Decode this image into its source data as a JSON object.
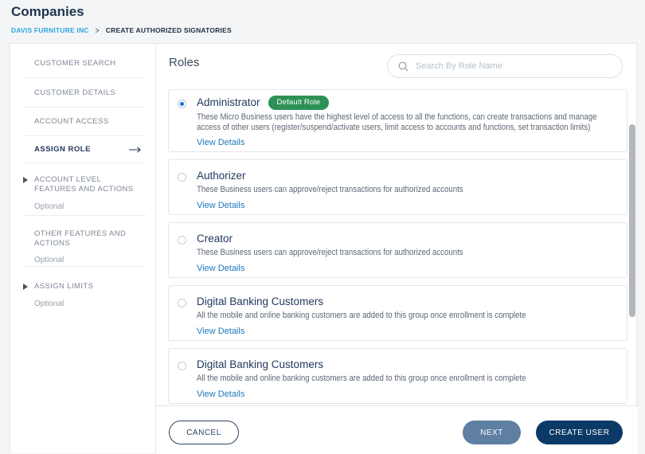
{
  "header": {
    "title": "Companies",
    "breadcrumb": {
      "parent": "DAVIS FURNITURE INC",
      "separator": ">",
      "current": "CREATE AUTHORIZED SIGNATORIES"
    }
  },
  "sidebar": {
    "items": [
      {
        "label": "CUSTOMER SEARCH"
      },
      {
        "label": "CUSTOMER DETAILS"
      },
      {
        "label": "ACCOUNT ACCESS"
      },
      {
        "label": "ASSIGN ROLE",
        "active": true
      },
      {
        "label": "ACCOUNT LEVEL FEATURES AND ACTIONS",
        "expandable": true,
        "optional": "Optional"
      },
      {
        "label": "OTHER FEATURES AND ACTIONS",
        "optional": "Optional"
      },
      {
        "label": "ASSIGN LIMITS",
        "expandable": true,
        "optional": "Optional"
      }
    ]
  },
  "main": {
    "heading": "Roles",
    "search_placeholder": "Search By Role Name",
    "view_details_label": "View Details",
    "roles": [
      {
        "name": "Administrator",
        "selected": true,
        "badge": "Default Role",
        "description": "These Micro Business users have the highest level of access to all the functions, can create transactions and manage access of other users (register/suspend/activate users, limit access to accounts and functions, set transaction limits)"
      },
      {
        "name": "Authorizer",
        "selected": false,
        "description": "These Business users can approve/reject transactions for authorized accounts"
      },
      {
        "name": "Creator",
        "selected": false,
        "description": "These Business users can approve/reject transactions for authorized accounts"
      },
      {
        "name": "Digital Banking Customers",
        "selected": false,
        "description": "All the mobile and online banking customers are added to this group once enrollment is complete"
      },
      {
        "name": "Digital Banking Customers",
        "selected": false,
        "description": "All the mobile and online banking customers are added to this group once enrollment is complete"
      }
    ]
  },
  "footer": {
    "cancel_label": "CANCEL",
    "next_label": "NEXT",
    "create_label": "CREATE USER"
  },
  "colors": {
    "accent_blue": "#2ea6df",
    "navy": "#0c3a67",
    "steel_blue": "#5e7ea2",
    "badge_green": "#2d9156",
    "link_blue": "#1f78ba",
    "radio_blue": "#1273d3"
  }
}
